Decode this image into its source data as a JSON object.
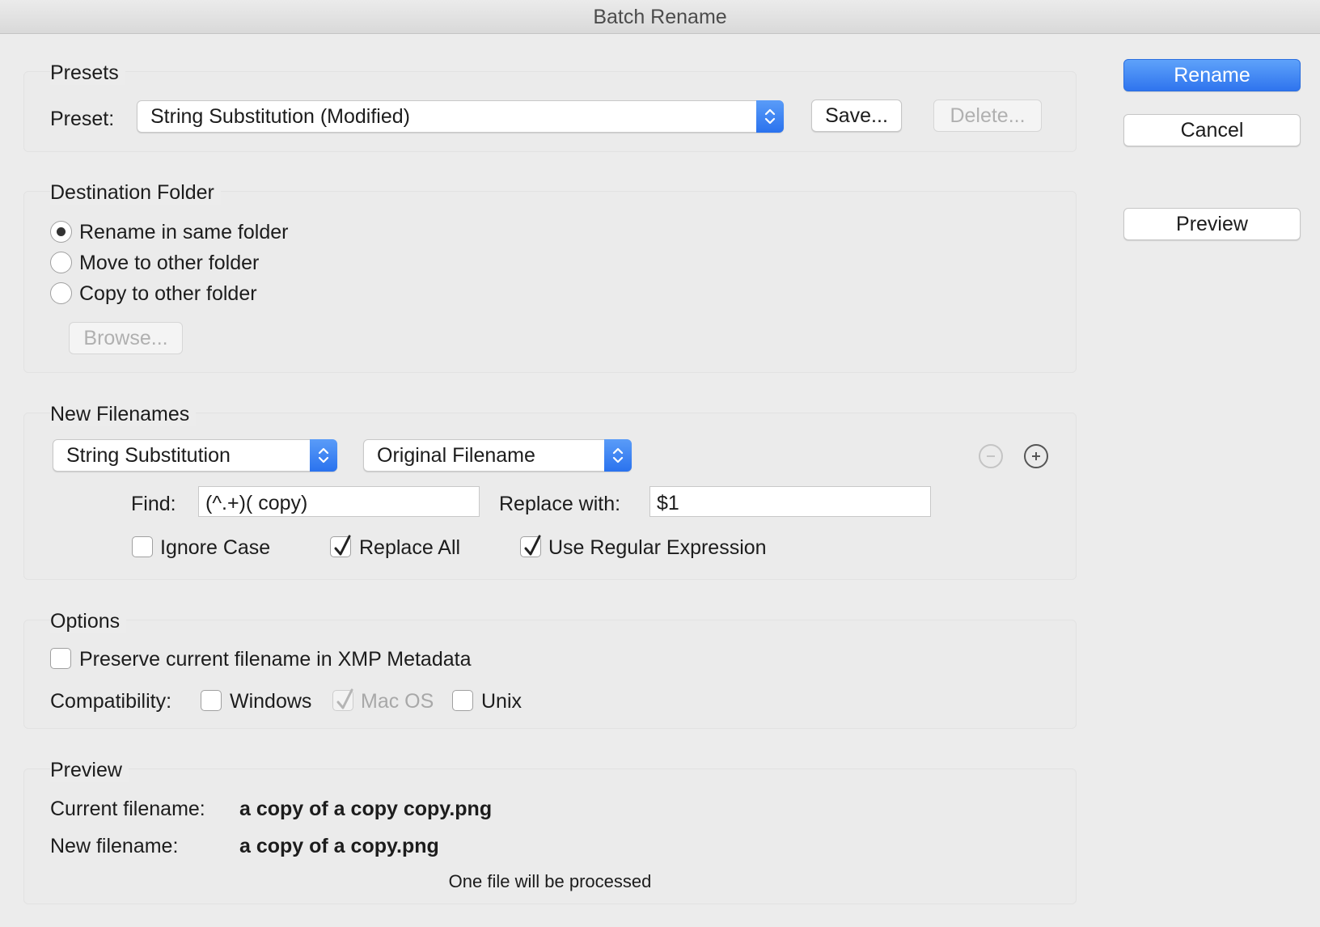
{
  "window": {
    "title": "Batch Rename"
  },
  "presets": {
    "group_title": "Presets",
    "preset_label": "Preset:",
    "preset_value": "String Substitution (Modified)",
    "save_label": "Save...",
    "delete_label": "Delete..."
  },
  "side_buttons": {
    "rename_label": "Rename",
    "cancel_label": "Cancel",
    "preview_label": "Preview"
  },
  "destination": {
    "group_title": "Destination Folder",
    "options": [
      {
        "label": "Rename in same folder",
        "selected": true
      },
      {
        "label": "Move to other folder",
        "selected": false
      },
      {
        "label": "Copy to other folder",
        "selected": false
      }
    ],
    "browse_label": "Browse..."
  },
  "new_filenames": {
    "group_title": "New Filenames",
    "method_value": "String Substitution",
    "source_value": "Original Filename",
    "find_label": "Find:",
    "find_value": "(^.+)( copy)",
    "replace_label": "Replace with:",
    "replace_value": "$1",
    "ignore_case": {
      "label": "Ignore Case",
      "checked": false
    },
    "replace_all": {
      "label": "Replace All",
      "checked": true
    },
    "use_regex": {
      "label": "Use Regular Expression",
      "checked": true
    }
  },
  "options": {
    "group_title": "Options",
    "preserve_xmp": {
      "label": "Preserve current filename in XMP Metadata",
      "checked": false
    },
    "compat_label": "Compatibility:",
    "windows": {
      "label": "Windows",
      "checked": false
    },
    "macos": {
      "label": "Mac OS",
      "checked": true,
      "disabled": true
    },
    "unix": {
      "label": "Unix",
      "checked": false
    }
  },
  "preview": {
    "group_title": "Preview",
    "current_label": "Current filename:",
    "current_value": "a copy of a copy copy.png",
    "new_label": "New filename:",
    "new_value": "a copy of a copy.png",
    "status": "One file will be processed"
  },
  "colors": {
    "accent": "#2f74ee",
    "window_bg": "#ececec"
  }
}
